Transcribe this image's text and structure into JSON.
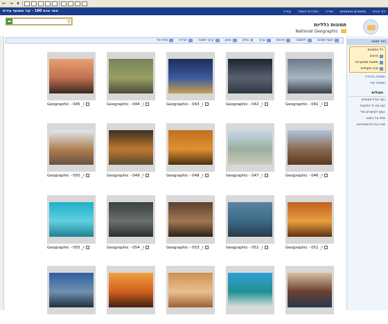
{
  "toolbar": {
    "buttons": [
      "back",
      "forward",
      "stop",
      "refresh",
      "home",
      "search",
      "favorites",
      "media",
      "history",
      "mail",
      "print",
      "edit"
    ]
  },
  "topnav": {
    "site_title": "אתר צוות 180 - קוד משותף עידית",
    "links": [
      "עזרה",
      "הגדרות האתר",
      "יצירה",
      "מסמכים ושיתופים",
      "דף הבית"
    ]
  },
  "header": {
    "title": "תמונות כלליות",
    "subtitle": "National Geographic",
    "search_value": ""
  },
  "actions": [
    "הוסף תמונה",
    "לתמונה",
    "פרטים",
    "מחק",
    "ערוך",
    "מסנן",
    "ערוך תמונה",
    "הורדה",
    "שלח אל"
  ],
  "sidebar": {
    "header": "בחר תצוגה",
    "views_title": "כל התמונות",
    "views": [
      "פרטים",
      "תמונות ממוזערות",
      "סרט שקופיות"
    ],
    "links": [
      "תמונות בבחירה",
      "תמונות שייר"
    ],
    "actions_title": "פעולות",
    "actions": [
      "הצג הגבל שקופיות",
      "הצג את כל התיקיות",
      "הוסף לקישורים שלי",
      "שלח אל המציג",
      "שינוי הגדרות ומאפיינים"
    ]
  },
  "tiles": [
    {
      "caption": "Geographic - 041 _l",
      "colors": [
        "#6b7a8a",
        "#a9b7c4",
        "#384048"
      ]
    },
    {
      "caption": "Geographic - 042 _l",
      "colors": [
        "#1c2430",
        "#59626e",
        "#2e3844"
      ]
    },
    {
      "caption": "Geographic - 043 _l",
      "colors": [
        "#1d2f5a",
        "#3c5aa0",
        "#c8a050"
      ]
    },
    {
      "caption": "Geographic - 044 _l",
      "colors": [
        "#76845a",
        "#9aa064",
        "#4a4a3a"
      ]
    },
    {
      "caption": "Geographic - 045 _l",
      "colors": [
        "#e8a070",
        "#c07050",
        "#382820"
      ]
    },
    {
      "caption": "Geographic - 046 _l",
      "colors": [
        "#b0c4e0",
        "#8a6a50",
        "#5a3820"
      ]
    },
    {
      "caption": "Geographic - 047 _l",
      "colors": [
        "#c8d8e8",
        "#9ab0a0",
        "#d0c8b8"
      ]
    },
    {
      "caption": "Geographic - 048 _l",
      "colors": [
        "#c07020",
        "#e09030",
        "#4a3010"
      ]
    },
    {
      "caption": "Geographic - 049 _l",
      "colors": [
        "#3a3020",
        "#c07830",
        "#5a4a30"
      ]
    },
    {
      "caption": "Geographic - 050 _l",
      "colors": [
        "#e0e8f0",
        "#b08050",
        "#6a5040"
      ]
    },
    {
      "caption": "Geographic - 051 _l",
      "colors": [
        "#c06020",
        "#e8a040",
        "#603010"
      ]
    },
    {
      "caption": "Geographic - 052 _l",
      "colors": [
        "#5a86a0",
        "#3a6a88",
        "#2a3a48"
      ]
    },
    {
      "caption": "Geographic - 053 _l",
      "colors": [
        "#5a4030",
        "#a07850",
        "#302018"
      ]
    },
    {
      "caption": "Geographic - 054 _l",
      "colors": [
        "#3a4040",
        "#6a7070",
        "#2a3030"
      ]
    },
    {
      "caption": "Geographic - 055 _l",
      "colors": [
        "#20b0c8",
        "#60d0e0",
        "#208090"
      ]
    },
    {
      "caption": "",
      "colors": [
        "#d8c0a0",
        "#6a4030",
        "#283850"
      ]
    },
    {
      "caption": "",
      "colors": [
        "#30a0d8",
        "#209090",
        "#e0e0e0"
      ]
    },
    {
      "caption": "",
      "colors": [
        "#d09050",
        "#e8c090",
        "#a06030"
      ]
    },
    {
      "caption": "",
      "colors": [
        "#f0a040",
        "#d06020",
        "#402010"
      ]
    },
    {
      "caption": "",
      "colors": [
        "#3060a0",
        "#7090b0",
        "#203040"
      ]
    }
  ]
}
